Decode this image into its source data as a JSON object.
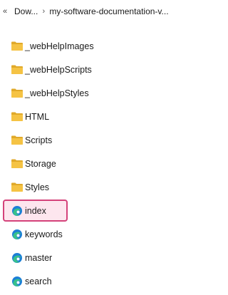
{
  "breadcrumb": {
    "back_glyph": "«",
    "separator": "›",
    "segments": [
      "Dow...",
      "my-software-documentation-v..."
    ]
  },
  "items": [
    {
      "label": "_webHelpImages",
      "icon": "folder-icon",
      "type": "folder"
    },
    {
      "label": "_webHelpScripts",
      "icon": "folder-icon",
      "type": "folder"
    },
    {
      "label": "_webHelpStyles",
      "icon": "folder-icon",
      "type": "folder"
    },
    {
      "label": "HTML",
      "icon": "folder-icon",
      "type": "folder"
    },
    {
      "label": "Scripts",
      "icon": "folder-icon",
      "type": "folder"
    },
    {
      "label": "Storage",
      "icon": "folder-icon",
      "type": "folder"
    },
    {
      "label": "Styles",
      "icon": "folder-icon",
      "type": "folder"
    },
    {
      "label": "index",
      "icon": "edge-html-file-icon",
      "type": "file",
      "selected": true
    },
    {
      "label": "keywords",
      "icon": "edge-html-file-icon",
      "type": "file"
    },
    {
      "label": "master",
      "icon": "edge-html-file-icon",
      "type": "file"
    },
    {
      "label": "search",
      "icon": "edge-html-file-icon",
      "type": "file"
    }
  ],
  "colors": {
    "folder": "#f5c344",
    "folder_dark": "#e0a92a",
    "selection_border": "#d4427a",
    "selection_fill": "#fde6ee",
    "edge_blue": "#1c7fd6",
    "edge_green": "#38c28a"
  }
}
